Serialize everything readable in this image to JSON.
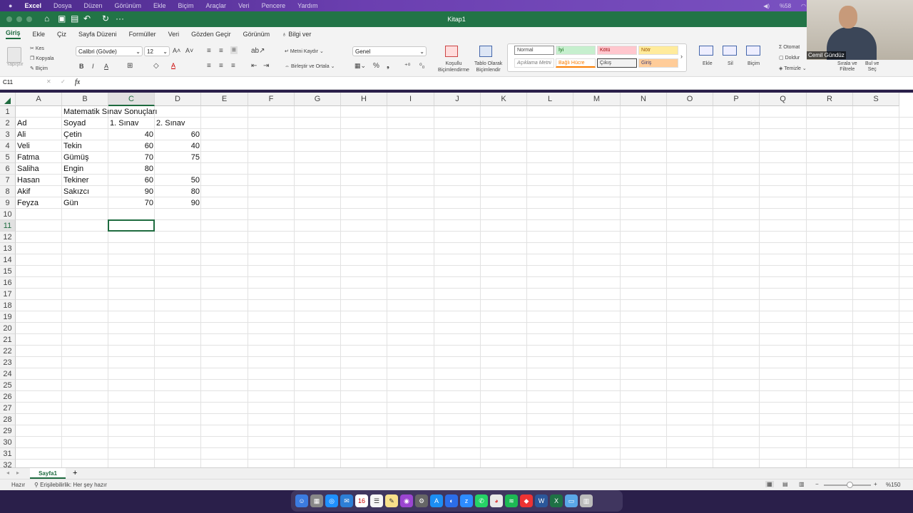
{
  "menubar": {
    "apple": "",
    "app": "Excel",
    "items": [
      "Dosya",
      "Düzen",
      "Görünüm",
      "Ekle",
      "Biçim",
      "Araçlar",
      "Veri",
      "Pencere",
      "Yardım"
    ],
    "battery": "%58"
  },
  "window": {
    "title": "Kitap1"
  },
  "ribbon_tabs": [
    "Giriş",
    "Ekle",
    "Çiz",
    "Sayfa Düzeni",
    "Formüller",
    "Veri",
    "Gözden Geçir",
    "Görünüm"
  ],
  "tell_me": "Bilgi ver",
  "ribbon": {
    "paste": "Yapıştır",
    "cut": "Kes",
    "copy": "Kopyala",
    "format": "Biçim",
    "font": "Calibri (Gövde)",
    "size": "12",
    "wrap": "Metni Kaydır",
    "merge": "Birleştir ve Ortala",
    "number_format": "Genel",
    "conditional": [
      "Koşullu",
      "Biçimlendirme"
    ],
    "table": [
      "Tablo Olarak",
      "Biçimlendir"
    ],
    "styles": [
      "Normal",
      "İyi",
      "Kötü",
      "Nötr",
      "Açıklama Metni",
      "Bağlı Hücre",
      "Çıkış",
      "Giriş"
    ],
    "insert": "Ekle",
    "delete": "Sil",
    "format2": "Biçim",
    "autosum": "Otomat",
    "fill": "Doldur",
    "clear": "Temizle",
    "sort": [
      "Sırala ve",
      "Filtrele"
    ],
    "find": [
      "Bul ve",
      "Seç"
    ]
  },
  "webcam": {
    "name": "Cemil Gündüz"
  },
  "formula_bar": {
    "cell_ref": "C11",
    "fx": "fx",
    "value": ""
  },
  "columns": [
    "A",
    "B",
    "C",
    "D",
    "E",
    "F",
    "G",
    "H",
    "I",
    "J",
    "K",
    "L",
    "M",
    "N",
    "O",
    "P",
    "Q",
    "R",
    "S"
  ],
  "rows": [
    "1",
    "2",
    "3",
    "4",
    "5",
    "6",
    "7",
    "8",
    "9",
    "10",
    "11",
    "12",
    "13",
    "14",
    "15",
    "16",
    "17",
    "18",
    "19",
    "20",
    "21",
    "22",
    "23",
    "24",
    "25",
    "26",
    "27",
    "28",
    "29",
    "30",
    "31",
    "32"
  ],
  "cells": {
    "title": "Matematik Sınav Sonuçları",
    "h_ad": "Ad",
    "h_soyad": "Soyad",
    "h_s1": "1. Sınav",
    "h_s2": "2. Sınav",
    "data": [
      {
        "ad": "Ali",
        "soyad": "Çetin",
        "s1": "40",
        "s2": "60"
      },
      {
        "ad": "Veli",
        "soyad": "Tekin",
        "s1": "60",
        "s2": "40"
      },
      {
        "ad": "Fatma",
        "soyad": "Gümüş",
        "s1": "70",
        "s2": "75"
      },
      {
        "ad": "Saliha",
        "soyad": "Engin",
        "s1": "80",
        "s2": ""
      },
      {
        "ad": "Hasan",
        "soyad": "Tekiner",
        "s1": "60",
        "s2": "50"
      },
      {
        "ad": "Akif",
        "soyad": "Sakızcı",
        "s1": "90",
        "s2": "80"
      },
      {
        "ad": "Feyza",
        "soyad": "Gün",
        "s1": "70",
        "s2": "90"
      }
    ]
  },
  "sheet_tab": "Sayfa1",
  "add_sheet": "+",
  "status": {
    "ready": "Hazır",
    "access": "Erişilebilirlik: Her şey hazır",
    "zoom": "%150"
  },
  "dock": {
    "calendar_day": "16"
  }
}
